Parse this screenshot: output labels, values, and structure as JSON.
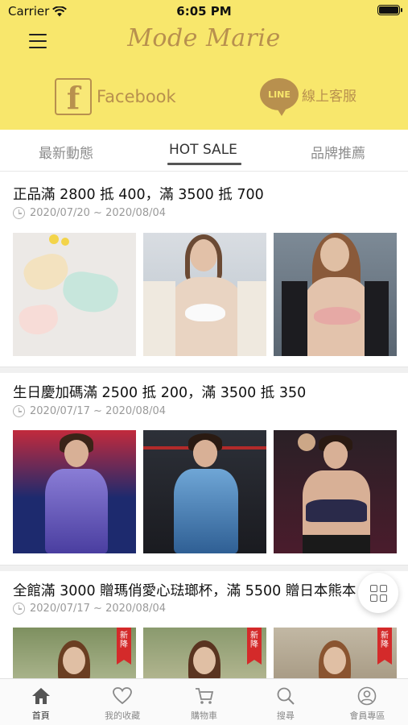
{
  "status_bar": {
    "carrier": "Carrier",
    "time": "6:05 PM"
  },
  "header": {
    "logo": "Mode Marie",
    "facebook": {
      "icon_letter": "f",
      "label": "Facebook"
    },
    "line": {
      "icon_text": "LINE",
      "label": "線上客服"
    }
  },
  "tabs": [
    {
      "label": "最新動態"
    },
    {
      "label": "HOT SALE",
      "active": true
    },
    {
      "label": "品牌推薦"
    }
  ],
  "sections": [
    {
      "title": "正品滿 2800 抵 400，滿 3500 抵 700",
      "date": "2020/07/20 ~ 2020/08/04",
      "images": [
        {
          "desc": "pastel-panties-flatlay",
          "bg": "#ece9e6"
        },
        {
          "desc": "model-white-bra-coat",
          "bg": "#c9cfd6"
        },
        {
          "desc": "model-pink-bra-blazer",
          "bg": "#6c7a86"
        }
      ]
    },
    {
      "title": "生日慶加碼滿 2500 抵 200，滿 3500 抵 350",
      "date": "2020/07/17 ~ 2020/08/04",
      "images": [
        {
          "desc": "model-purple-tank-gym",
          "bg": "#1d2a6e"
        },
        {
          "desc": "model-blue-tank-gym",
          "bg": "#2a2c33"
        },
        {
          "desc": "model-sports-bra-gym",
          "bg": "#3a1c2a"
        }
      ]
    },
    {
      "title": "全館滿 3000 贈瑪俏愛心琺瑯杯，滿 5500 贈日本熊本",
      "date": "2020/07/17 ~ 2020/08/04",
      "new_tag": "新降",
      "images": [
        {
          "desc": "model-outdoor-1",
          "bg": "#8a9a6a"
        },
        {
          "desc": "model-outdoor-2",
          "bg": "#9aa07a"
        },
        {
          "desc": "model-outdoor-3",
          "bg": "#b8ae9a"
        }
      ]
    }
  ],
  "bottom_nav": [
    {
      "label": "首頁",
      "icon": "home-icon",
      "active": true
    },
    {
      "label": "我的收藏",
      "icon": "heart-icon"
    },
    {
      "label": "購物車",
      "icon": "cart-icon"
    },
    {
      "label": "搜尋",
      "icon": "search-icon"
    },
    {
      "label": "會員專區",
      "icon": "user-icon"
    }
  ],
  "colors": {
    "header_bg": "#f8e76c",
    "brand_gold": "#b8904e",
    "new_tag": "#d42a2a"
  }
}
